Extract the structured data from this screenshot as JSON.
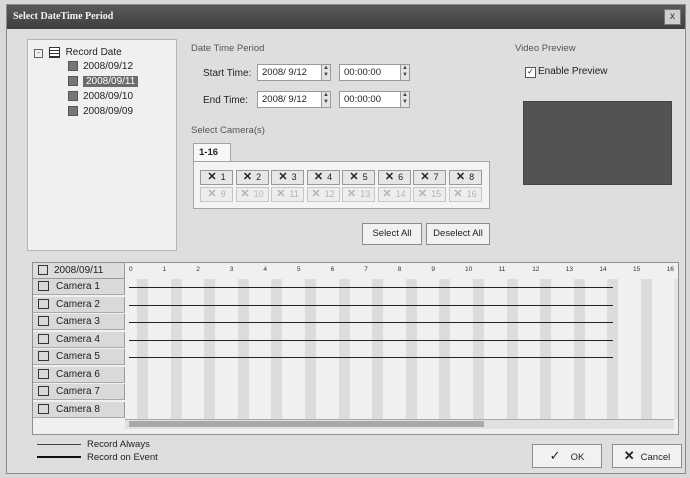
{
  "window": {
    "title": "Select DateTime Period",
    "close_label": "x"
  },
  "tree": {
    "root_label": "Record Date",
    "items": [
      {
        "label": "2008/09/12",
        "selected": false
      },
      {
        "label": "2008/09/11",
        "selected": true
      },
      {
        "label": "2008/09/10",
        "selected": false
      },
      {
        "label": "2008/09/09",
        "selected": false
      }
    ]
  },
  "period": {
    "group_label": "Date Time Period",
    "start_label": "Start Time:",
    "start_date": "2008/ 9/12",
    "start_time": "00:00:00",
    "end_label": "End Time:",
    "end_date": "2008/ 9/12",
    "end_time": "00:00:00"
  },
  "camera_select": {
    "group_label": "Select Camera(s)",
    "tab_label": "1-16",
    "cameras": [
      {
        "label": "1",
        "enabled": true
      },
      {
        "label": "2",
        "enabled": true
      },
      {
        "label": "3",
        "enabled": true
      },
      {
        "label": "4",
        "enabled": true
      },
      {
        "label": "5",
        "enabled": true
      },
      {
        "label": "6",
        "enabled": true
      },
      {
        "label": "7",
        "enabled": true
      },
      {
        "label": "8",
        "enabled": true
      },
      {
        "label": "9",
        "enabled": false
      },
      {
        "label": "10",
        "enabled": false
      },
      {
        "label": "11",
        "enabled": false
      },
      {
        "label": "12",
        "enabled": false
      },
      {
        "label": "13",
        "enabled": false
      },
      {
        "label": "14",
        "enabled": false
      },
      {
        "label": "15",
        "enabled": false
      },
      {
        "label": "16",
        "enabled": false
      }
    ],
    "select_all": "Select All",
    "deselect_all": "Deselect All"
  },
  "video_preview": {
    "group_label": "Video Preview",
    "enable_label": "Enable Preview",
    "enabled": true
  },
  "timeline": {
    "date": "2008/09/11",
    "hours": [
      "0",
      "1",
      "2",
      "3",
      "4",
      "5",
      "6",
      "7",
      "8",
      "9",
      "10",
      "11",
      "12",
      "13",
      "14",
      "15",
      "16"
    ],
    "rows": [
      {
        "label": "Camera 1",
        "record_end_hour": 14.4
      },
      {
        "label": "Camera 2",
        "record_end_hour": 14.4
      },
      {
        "label": "Camera 3",
        "record_end_hour": 14.4
      },
      {
        "label": "Camera 4",
        "record_end_hour": 14.4
      },
      {
        "label": "Camera 5",
        "record_end_hour": 14.4
      },
      {
        "label": "Camera 6",
        "record_end_hour": null
      },
      {
        "label": "Camera 7",
        "record_end_hour": null
      },
      {
        "label": "Camera 8",
        "record_end_hour": null
      }
    ]
  },
  "legend": {
    "always": "Record Always",
    "event": "Record on Event"
  },
  "buttons": {
    "ok": "OK",
    "cancel": "Cancel",
    "ok_icon": "check-icon",
    "cancel_icon": "x-icon"
  }
}
